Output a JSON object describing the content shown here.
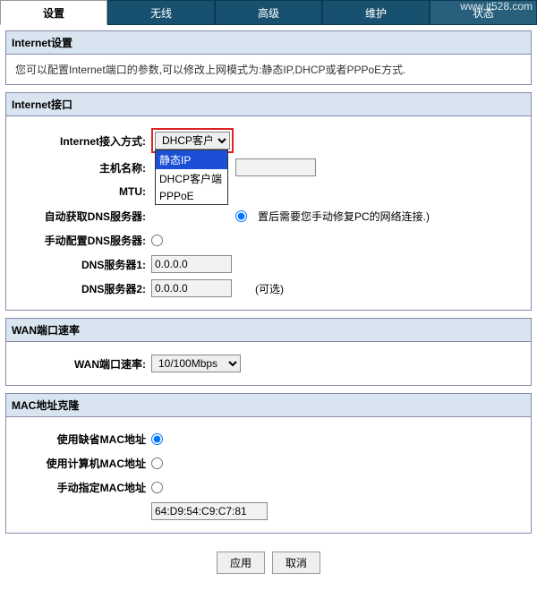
{
  "watermark": "www.it528.com",
  "tabs": {
    "t0": "设置",
    "t1": "无线",
    "t2": "高级",
    "t3": "维护",
    "t4": "状态"
  },
  "sec1": {
    "title": "Internet设置",
    "desc": "您可以配置Internet端口的参数,可以修改上网模式为:静态IP,DHCP或者PPPoE方式."
  },
  "sec2": {
    "title": "Internet接口",
    "access_mode_label": "Internet接入方式:",
    "access_mode_value": "DHCP客户端",
    "dd": {
      "opt0": "静态IP",
      "opt1": "DHCP客户端",
      "opt2": "PPPoE"
    },
    "host_label": "主机名称:",
    "host_value": "",
    "mtu_label": "MTU:",
    "mtu_note": "置后需要您手动修复PC的网络连接.)",
    "autodns_label": "自动获取DNS服务器:",
    "manualdns_label": "手动配置DNS服务器:",
    "dns1_label": "DNS服务器1:",
    "dns1_value": "0.0.0.0",
    "dns2_label": "DNS服务器2:",
    "dns2_value": "0.0.0.0",
    "optional": "(可选)"
  },
  "sec3": {
    "title": "WAN端口速率",
    "rate_label": "WAN端口速率:",
    "rate_value": "10/100Mbps"
  },
  "sec4": {
    "title": "MAC地址克隆",
    "r0": "使用缺省MAC地址",
    "r1": "使用计算机MAC地址",
    "r2": "手动指定MAC地址",
    "mac_value": "64:D9:54:C9:C7:81"
  },
  "btns": {
    "apply": "应用",
    "cancel": "取消"
  }
}
